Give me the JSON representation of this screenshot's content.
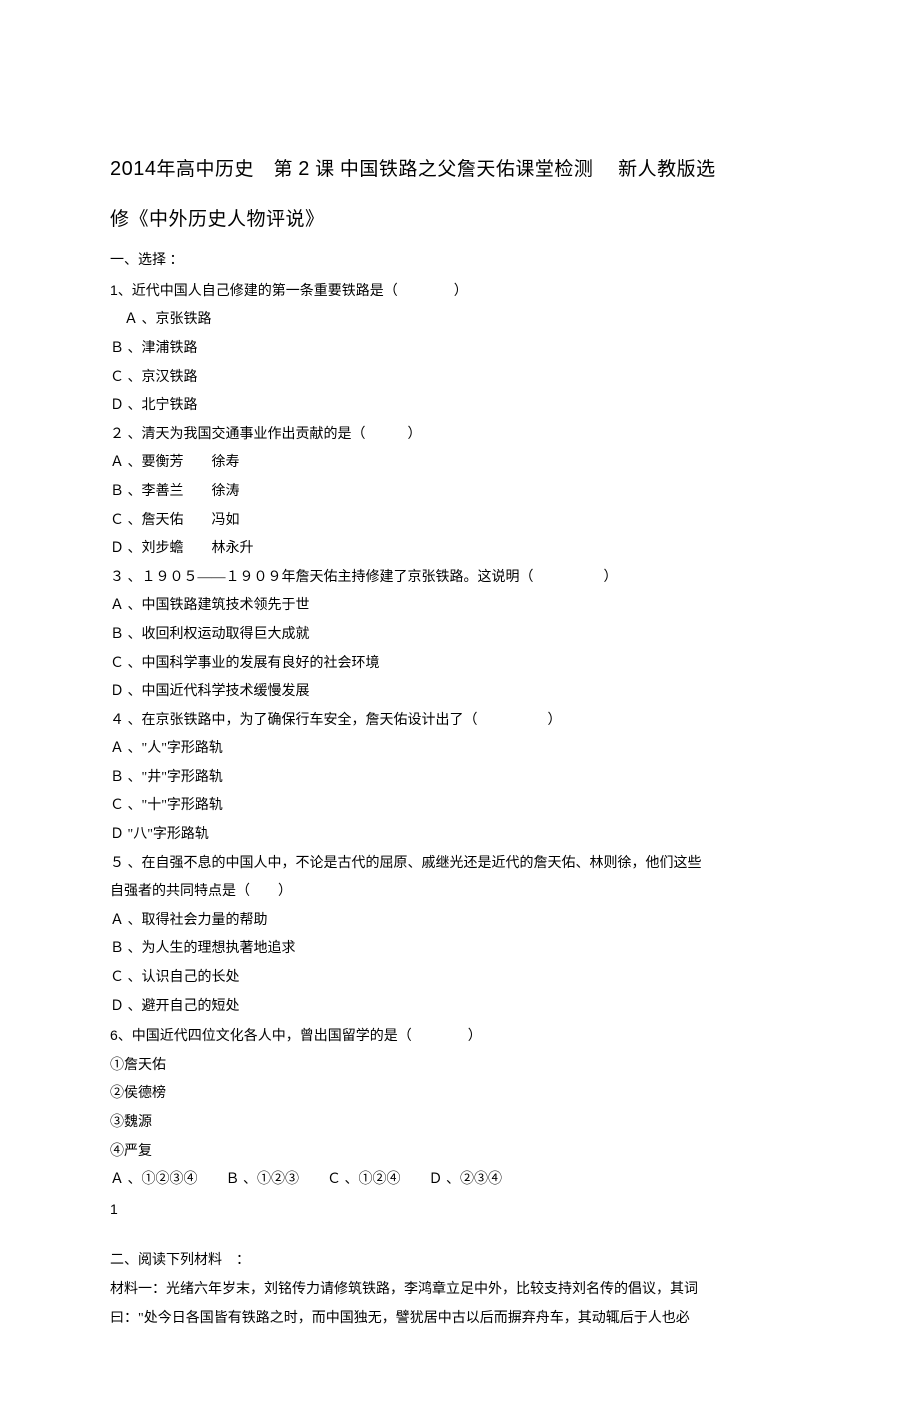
{
  "title": {
    "line1_prefix": "2014",
    "line1_mid": "年高中历史　第 ",
    "line1_num": "2",
    "line1_suffix": " 课 中国铁路之父詹天佑课堂检测　 新人教版选",
    "line2": "修《中外历史人物评说》"
  },
  "section1_header": "一、选择 ：",
  "q1": {
    "num_prefix": "1",
    "stem": "、近代中国人自己修建的第一条重要铁路是（　　　　）",
    "a": "Ａ 、京张铁路",
    "b": "Ｂ 、津浦铁路",
    "c": "Ｃ 、京汉铁路",
    "d": "Ｄ 、北宁铁路"
  },
  "q2": {
    "stem": "２ 、清天为我国交通事业作出贡献的是（　　　）",
    "a": "Ａ 、要衡芳　　徐寿",
    "b": "Ｂ 、李善兰　　徐涛",
    "c": "Ｃ 、詹天佑　　冯如",
    "d": "Ｄ 、刘步蟾　　林永升"
  },
  "q3": {
    "stem": "３ 、１９０５——１９０９年詹天佑主持修建了京张铁路。这说明（　　　　　）",
    "a": "Ａ 、中国铁路建筑技术领先于世",
    "b": "Ｂ 、收回利权运动取得巨大成就",
    "c": "Ｃ 、中国科学事业的发展有良好的社会环境",
    "d": "Ｄ 、中国近代科学技术缓慢发展"
  },
  "q4": {
    "stem": "４ 、在京张铁路中，为了确保行车安全，詹天佑设计出了（　　　　　）",
    "a": "Ａ 、\"人\"字形路轨",
    "b": "Ｂ 、\"井\"字形路轨",
    "c": "Ｃ 、\"十\"字形路轨",
    "d": "Ｄ \"八\"字形路轨"
  },
  "q5": {
    "stem1": "５ 、在自强不息的中国人中，不论是古代的屈原、戚继光还是近代的詹天佑、林则徐，他们这些",
    "stem2": "自强者的共同特点是（　　）",
    "a": "Ａ 、取得社会力量的帮助",
    "b": "Ｂ 、为人生的理想执著地追求",
    "c": "Ｃ 、认识自己的长处",
    "d": "Ｄ 、避开自己的短处"
  },
  "q6": {
    "num_prefix": "6",
    "stem": "、中国近代四位文化各人中，曾出国留学的是（　　　　）",
    "opt1": "①詹天佑",
    "opt2": "②侯德榜",
    "opt3": "③魏源",
    "opt4": "④严复",
    "choices": "Ａ 、①②③④　　Ｂ 、①②③　　Ｃ 、①②④　　Ｄ 、②③④"
  },
  "page_num": "1",
  "section2_header": "二、阅读下列材料　：",
  "material": {
    "line1": "材料一：光绪六年岁末，刘铭传力请修筑铁路，李鸿章立足中外，比较支持刘名传的倡议，其词",
    "line2": "曰：\"处今日各国皆有铁路之时，而中国独无，譬犹居中古以后而摒弃舟车，其动辄后于人也必"
  }
}
